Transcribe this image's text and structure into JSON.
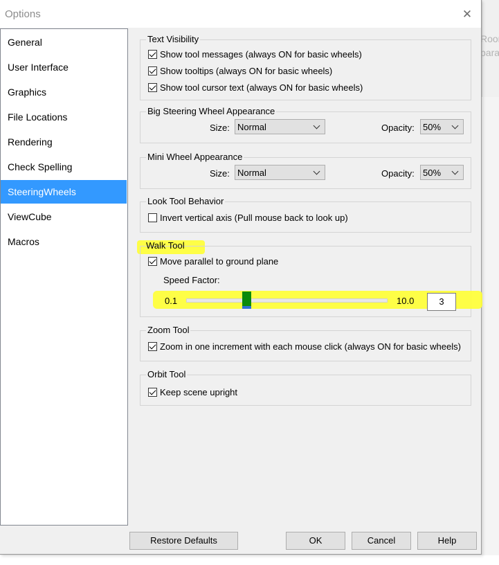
{
  "window": {
    "title": "Options",
    "close_glyph": "✕"
  },
  "background": {
    "fragment_line1": "Roor",
    "fragment_line2": "para"
  },
  "sidebar": {
    "items": [
      {
        "label": "General"
      },
      {
        "label": "User Interface"
      },
      {
        "label": "Graphics"
      },
      {
        "label": "File Locations"
      },
      {
        "label": "Rendering"
      },
      {
        "label": "Check Spelling"
      },
      {
        "label": "SteeringWheels",
        "selected": true
      },
      {
        "label": "ViewCube"
      },
      {
        "label": "Macros"
      }
    ]
  },
  "text_visibility": {
    "title": "Text Visibility",
    "show_tool_messages": {
      "label": "Show tool messages (always ON for basic wheels)",
      "checked": true
    },
    "show_tooltips": {
      "label": "Show tooltips (always ON for basic wheels)",
      "checked": true
    },
    "show_cursor_text": {
      "label": "Show tool cursor text (always ON for basic wheels)",
      "checked": true
    }
  },
  "big_wheel": {
    "title": "Big Steering Wheel Appearance",
    "size_label": "Size:",
    "size_value": "Normal",
    "opacity_label": "Opacity:",
    "opacity_value": "50%"
  },
  "mini_wheel": {
    "title": "Mini Wheel Appearance",
    "size_label": "Size:",
    "size_value": "Normal",
    "opacity_label": "Opacity:",
    "opacity_value": "50%"
  },
  "look_tool": {
    "title": "Look Tool Behavior",
    "invert_axis": {
      "label": "Invert vertical axis (Pull mouse back to look up)",
      "checked": false
    }
  },
  "walk_tool": {
    "title": "Walk Tool",
    "move_parallel": {
      "label": "Move parallel to ground plane",
      "checked": true
    },
    "speed_label": "Speed Factor:",
    "speed_min": "0.1",
    "speed_max": "10.0",
    "speed_value": "3"
  },
  "zoom_tool": {
    "title": "Zoom Tool",
    "one_increment": {
      "label": "Zoom in one increment with each mouse click (always ON for basic wheels)",
      "checked": true
    }
  },
  "orbit_tool": {
    "title": "Orbit Tool",
    "keep_upright": {
      "label": "Keep scene upright",
      "checked": true
    }
  },
  "footer": {
    "restore_label": "Restore Defaults",
    "ok_label": "OK",
    "cancel_label": "Cancel",
    "help_label": "Help"
  },
  "colors": {
    "selection": "#3399ff",
    "highlight": "#ffff33",
    "slider_thumb": "#0b8a0b"
  }
}
